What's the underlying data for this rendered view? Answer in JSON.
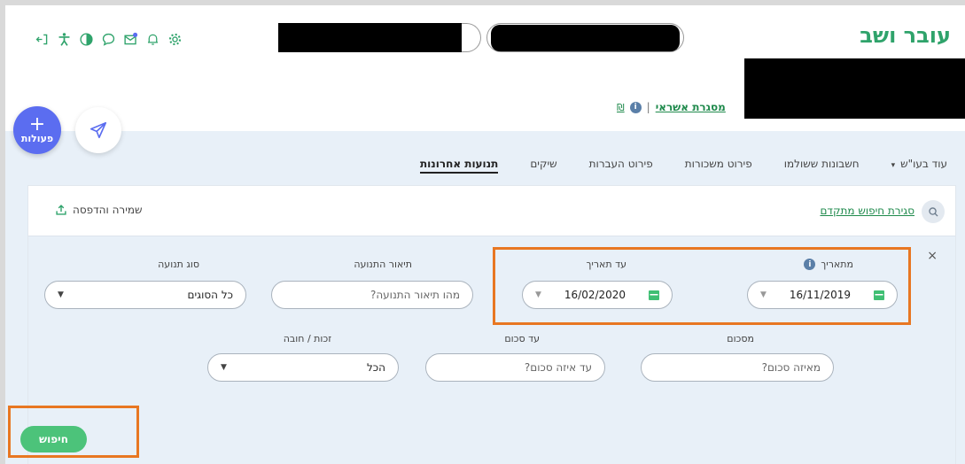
{
  "header": {
    "brand": "עובר ושב",
    "colors": {
      "brand": "#2fa36b",
      "accent": "#5b6df0",
      "highlight": "#e87722",
      "button": "#4cc37a"
    },
    "toolbar_icons": [
      "logout-icon",
      "accessibility-icon",
      "contrast-icon",
      "chat-icon",
      "mail-icon",
      "bell-icon",
      "gear-icon"
    ]
  },
  "credit": {
    "link": "מסגרת אשראי",
    "separator": "|",
    "info": "i",
    "currency": "₪"
  },
  "actions": {
    "fab_label": "פעולות",
    "fab_plus": "+"
  },
  "tabs": [
    {
      "label": "תנועות אחרונות",
      "active": true
    },
    {
      "label": "שיקים"
    },
    {
      "label": "פירוט העברות"
    },
    {
      "label": "פירוט משכורות"
    },
    {
      "label": "חשבונות ששולמו"
    },
    {
      "label": "עוד בעו\"ש",
      "caret": "▾"
    }
  ],
  "panel": {
    "close_advanced": "סגירת חיפוש מתקדם",
    "save_print": "שמירה והדפסה",
    "close_x": "×",
    "from_date": {
      "label": "מתאריך",
      "value": "16/11/2019"
    },
    "to_date": {
      "label": "עד תאריך",
      "value": "16/02/2020"
    },
    "description": {
      "label": "תיאור התנועה",
      "placeholder": "מהו תיאור התנועה?"
    },
    "type": {
      "label": "סוג תנועה",
      "value": "כל הסוגים"
    },
    "amount": {
      "label": "מסכום",
      "placeholder": "מאיזה סכום?"
    },
    "amount_to": {
      "label": "עד סכום",
      "placeholder": "עד איזה סכום?"
    },
    "credit_debit": {
      "label": "זכות / חובה",
      "value": "הכל"
    },
    "search_button": "חיפוש"
  }
}
